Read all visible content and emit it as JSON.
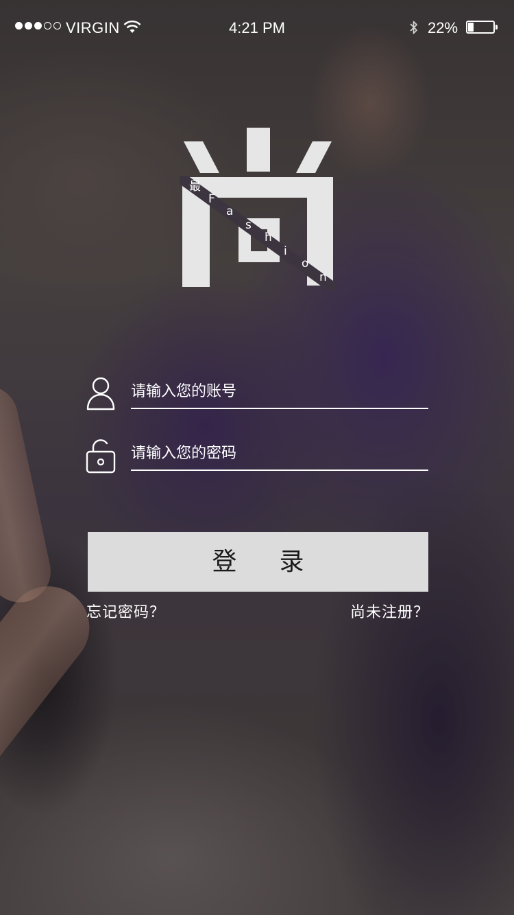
{
  "status_bar": {
    "carrier": "VIRGIN",
    "time": "4:21 PM",
    "battery_percent": "22%",
    "battery_level": 0.22,
    "signal_bars_filled": 3,
    "signal_bars_total": 5
  },
  "logo": {
    "character": "尚",
    "small_char": "最",
    "letters": [
      "F",
      "a",
      "s",
      "h",
      "i",
      "o",
      "n"
    ]
  },
  "login_form": {
    "account_placeholder": "请输入您的账号",
    "password_placeholder": "请输入您的密码",
    "login_label": "登录",
    "forgot_password": "忘记密码？",
    "register": "尚未注册？"
  },
  "colors": {
    "button_bg": "#dcdcdc",
    "button_text": "#1a1a1a",
    "accent_text": "#ffffff"
  }
}
